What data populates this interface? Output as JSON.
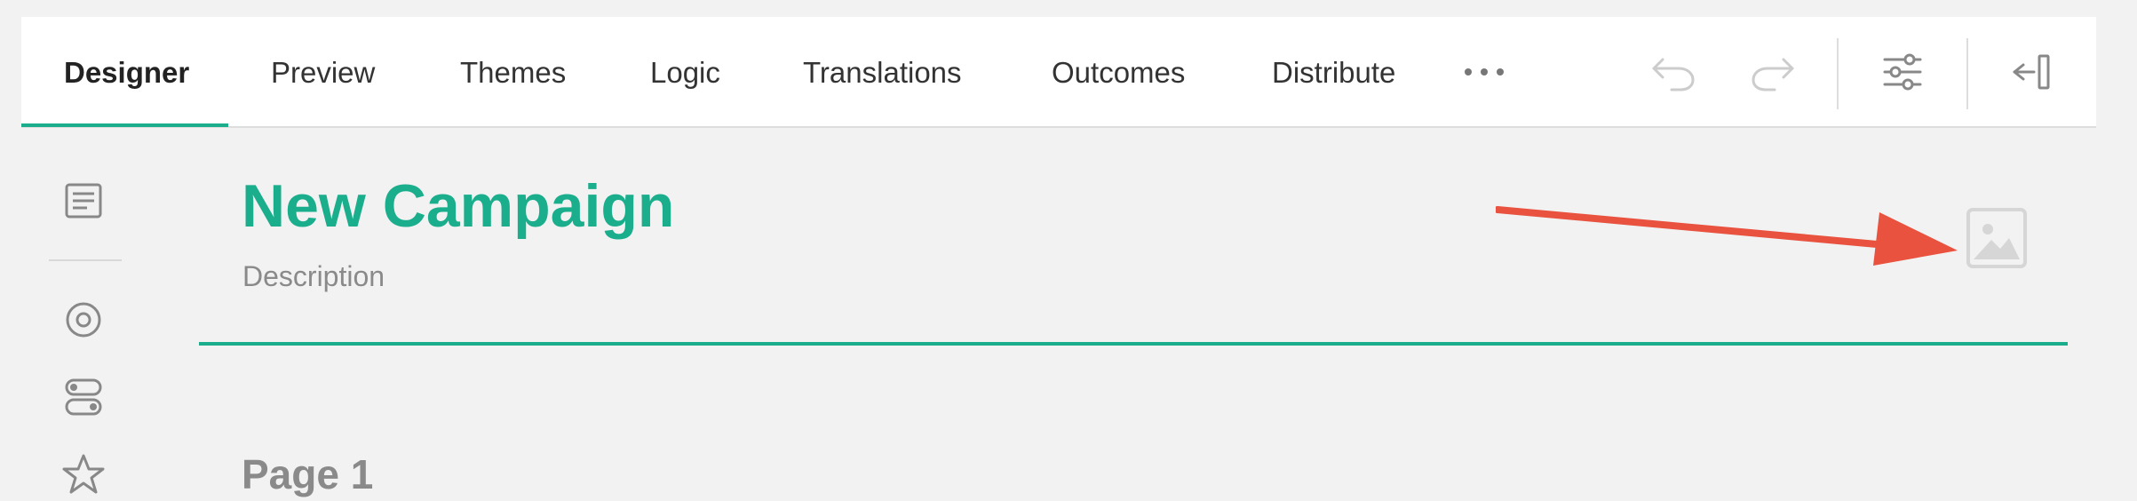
{
  "tabs": [
    {
      "label": "Designer",
      "active": true
    },
    {
      "label": "Preview",
      "active": false
    },
    {
      "label": "Themes",
      "active": false
    },
    {
      "label": "Logic",
      "active": false
    },
    {
      "label": "Translations",
      "active": false
    },
    {
      "label": "Outcomes",
      "active": false
    },
    {
      "label": "Distribute",
      "active": false
    }
  ],
  "toolbar": {
    "more_icon": "more-horizontal-icon",
    "undo_icon": "undo-icon",
    "redo_icon": "redo-icon",
    "settings_icon": "sliders-icon",
    "collapse_icon": "collapse-panel-icon"
  },
  "sidebar": {
    "items": [
      {
        "icon": "page-icon"
      },
      {
        "icon": "radio-target-icon"
      },
      {
        "icon": "toggles-icon"
      },
      {
        "icon": "star-icon"
      }
    ]
  },
  "main": {
    "title": "New Campaign",
    "description": "Description",
    "page_title": "Page 1",
    "image_placeholder_icon": "image-icon",
    "annotation": "red-arrow"
  },
  "colors": {
    "accent": "#1aae8c",
    "annotation": "#e8523f",
    "muted": "#8a8a8a",
    "icon_gray": "#888888"
  }
}
